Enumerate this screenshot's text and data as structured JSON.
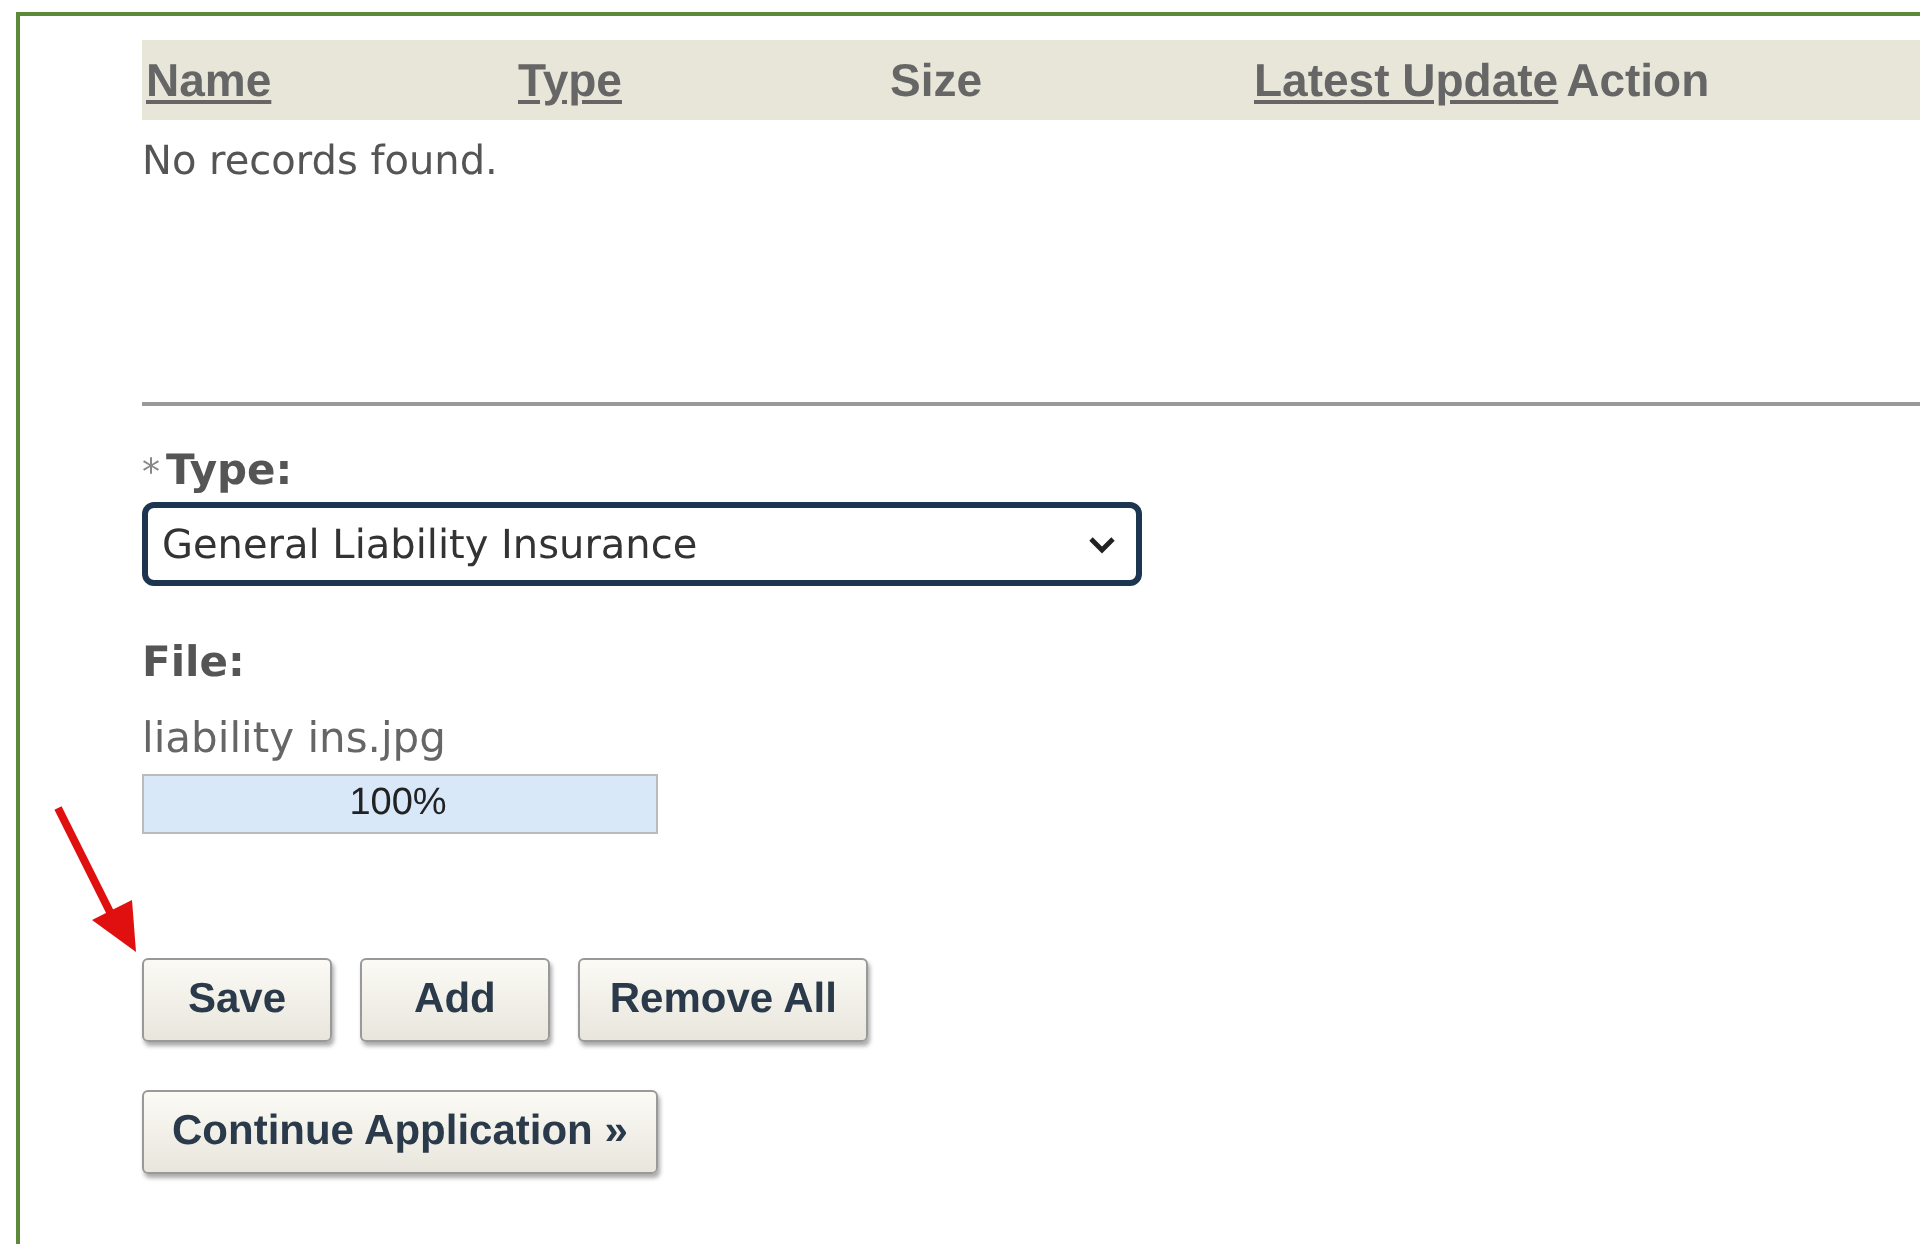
{
  "table": {
    "columns": [
      {
        "label": "Name",
        "sortable": true
      },
      {
        "label": "Type",
        "sortable": true
      },
      {
        "label": "Size",
        "sortable": false
      },
      {
        "label": "Latest Update",
        "sortable": true
      },
      {
        "label": "Action",
        "sortable": false
      }
    ],
    "empty_message": "No records found."
  },
  "type_field": {
    "required_mark": "*",
    "label": "Type:",
    "value": "General Liability Insurance"
  },
  "file_field": {
    "label": "File:",
    "file_name": "liability ins.jpg",
    "progress": {
      "level": 1,
      "reading": "100%"
    }
  },
  "buttons": [
    {
      "label": "Save"
    },
    {
      "label": "Add"
    },
    {
      "label": "Remove All"
    }
  ],
  "continue_button": {
    "label": "Continue Application »"
  },
  "annotation": {
    "kind": "arrow"
  }
}
